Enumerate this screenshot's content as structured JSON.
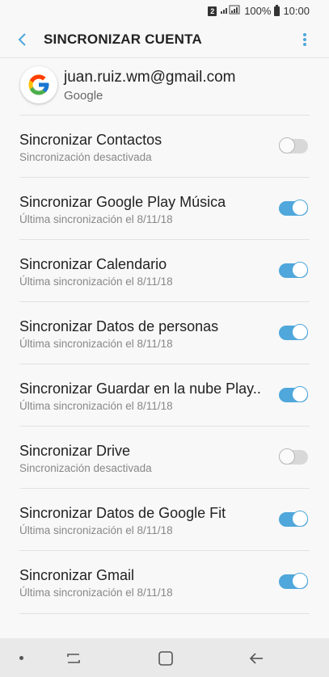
{
  "status_bar": {
    "sim_slot": "2",
    "battery_percent": "100%",
    "time": "10:00"
  },
  "app_bar": {
    "title": "SINCRONIZAR CUENTA",
    "back_icon": "chevron-left-icon",
    "more_icon": "more-vertical-icon"
  },
  "account": {
    "email": "juan.ruiz.wm@gmail.com",
    "type": "Google",
    "avatar_icon": "google-logo-icon"
  },
  "sync_items": [
    {
      "title": "Sincronizar Contactos",
      "subtitle": "Sincronización desactivada",
      "enabled": false
    },
    {
      "title": "Sincronizar Google Play Música",
      "subtitle": "Última sincronización el 8/11/18",
      "enabled": true
    },
    {
      "title": "Sincronizar Calendario",
      "subtitle": "Última sincronización el 8/11/18",
      "enabled": true
    },
    {
      "title": "Sincronizar Datos de personas",
      "subtitle": "Última sincronización el 8/11/18",
      "enabled": true
    },
    {
      "title": "Sincronizar Guardar en la nube Play..",
      "subtitle": "Última sincronización el 8/11/18",
      "enabled": true
    },
    {
      "title": "Sincronizar Drive",
      "subtitle": "Sincronización desactivada",
      "enabled": false
    },
    {
      "title": "Sincronizar Datos de Google Fit",
      "subtitle": "Última sincronización el 8/11/18",
      "enabled": true
    },
    {
      "title": "Sincronizar Gmail",
      "subtitle": "Última sincronización el 8/11/18",
      "enabled": true
    }
  ],
  "colors": {
    "toggle_on": "#4fa7db",
    "toggle_off": "#d8d8d8",
    "accent": "#4fa7db"
  }
}
